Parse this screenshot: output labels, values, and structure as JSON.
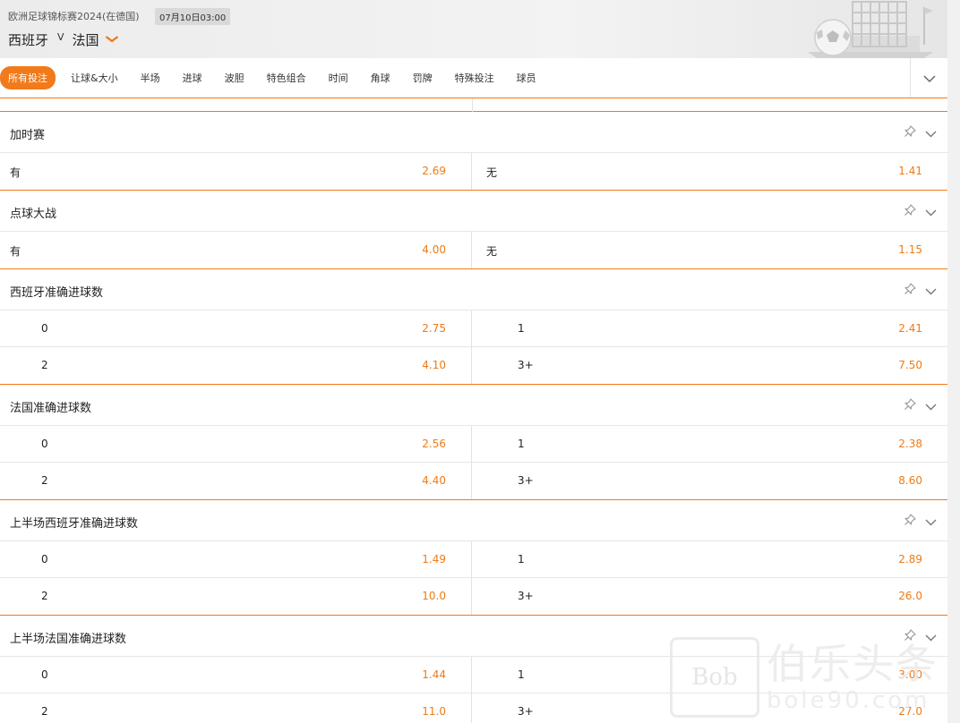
{
  "header": {
    "league": "欧洲足球锦标赛2024(在德国)",
    "datetime": "07月10日03:00",
    "home_team": "西班牙",
    "vs": "V",
    "away_team": "法国"
  },
  "tabs": [
    "所有投注",
    "让球&大小",
    "半场",
    "进球",
    "波胆",
    "特色组合",
    "时间",
    "角球",
    "罚牌",
    "特殊投注",
    "球员"
  ],
  "active_tab": "所有投注",
  "markets": [
    {
      "title": "加时赛",
      "rows": [
        [
          {
            "sel": "有",
            "odds": "2.69"
          },
          {
            "sel": "无",
            "odds": "1.41"
          }
        ]
      ]
    },
    {
      "title": "点球大战",
      "rows": [
        [
          {
            "sel": "有",
            "odds": "4.00"
          },
          {
            "sel": "无",
            "odds": "1.15"
          }
        ]
      ]
    },
    {
      "title": "西班牙准确进球数",
      "rows": [
        [
          {
            "sel": "0",
            "odds": "2.75"
          },
          {
            "sel": "1",
            "odds": "2.41"
          }
        ],
        [
          {
            "sel": "2",
            "odds": "4.10"
          },
          {
            "sel": "3+",
            "odds": "7.50"
          }
        ]
      ]
    },
    {
      "title": "法国准确进球数",
      "rows": [
        [
          {
            "sel": "0",
            "odds": "2.56"
          },
          {
            "sel": "1",
            "odds": "2.38"
          }
        ],
        [
          {
            "sel": "2",
            "odds": "4.40"
          },
          {
            "sel": "3+",
            "odds": "8.60"
          }
        ]
      ]
    },
    {
      "title": "上半场西班牙准确进球数",
      "rows": [
        [
          {
            "sel": "0",
            "odds": "1.49"
          },
          {
            "sel": "1",
            "odds": "2.89"
          }
        ],
        [
          {
            "sel": "2",
            "odds": "10.0"
          },
          {
            "sel": "3+",
            "odds": "26.0"
          }
        ]
      ]
    },
    {
      "title": "上半场法国准确进球数",
      "rows": [
        [
          {
            "sel": "0",
            "odds": "1.44"
          },
          {
            "sel": "1",
            "odds": "3.00"
          }
        ],
        [
          {
            "sel": "2",
            "odds": "11.0"
          },
          {
            "sel": "3+",
            "odds": "27.0"
          }
        ]
      ]
    }
  ],
  "watermark": {
    "badge": "Bob",
    "text_big": "伯乐头条",
    "text_small": "bole90.com"
  },
  "colors": {
    "accent": "#f07a16",
    "divider": "#e6e6e6",
    "header_bg": "#ececec"
  },
  "icons": {
    "pin": "pin-icon",
    "collapse": "chevron-down-icon",
    "tabs_expand": "chevron-down-icon"
  }
}
